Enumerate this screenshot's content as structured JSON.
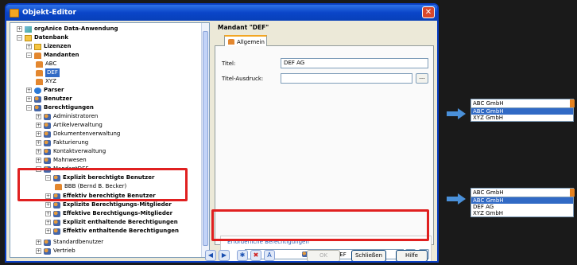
{
  "window": {
    "title": "Objekt-Editor"
  },
  "tree": {
    "items": [
      {
        "label": "orgAnice Data-Anwendung",
        "bold": true
      },
      {
        "label": "Datenbank",
        "bold": true
      },
      {
        "label": "Lizenzen",
        "bold": true
      },
      {
        "label": "Mandanten",
        "bold": true
      },
      {
        "label": "ABC",
        "bold": false
      },
      {
        "label": "DEF",
        "bold": false,
        "selected": true
      },
      {
        "label": "XYZ",
        "bold": false
      },
      {
        "label": "Parser",
        "bold": true
      },
      {
        "label": "Benutzer",
        "bold": true
      },
      {
        "label": "Berechtigungen",
        "bold": true
      },
      {
        "label": "Administratoren",
        "bold": false
      },
      {
        "label": "Artikelverwaltung",
        "bold": false
      },
      {
        "label": "Dokumentenverwaltung",
        "bold": false
      },
      {
        "label": "Fakturierung",
        "bold": false
      },
      {
        "label": "Kontaktverwaltung",
        "bold": false
      },
      {
        "label": "Mahnwesen",
        "bold": false
      },
      {
        "label": "MandantDEF",
        "bold": false
      },
      {
        "label": "Explizit berechtigte Benutzer",
        "bold": true
      },
      {
        "label": "BBB (Bernd B. Becker)",
        "bold": false
      },
      {
        "label": "Effektiv berechtigte Benutzer",
        "bold": true
      },
      {
        "label": "Explizite Berechtigungs-Mitglieder",
        "bold": true
      },
      {
        "label": "Effektive Berechtigungs-Mitglieder",
        "bold": true
      },
      {
        "label": "Explizit enthaltende Berechtigungen",
        "bold": true
      },
      {
        "label": "Effektiv enthaltende Berechtigungen",
        "bold": true
      },
      {
        "label": "Standardbenutzer",
        "bold": false
      },
      {
        "label": "Vertrieb",
        "bold": false
      }
    ]
  },
  "editor": {
    "header": "Mandant \"DEF\"",
    "tab_label": "Allgemein",
    "titel_label": "Titel:",
    "titel_value": "DEF AG",
    "titel_ausdruck_label": "Titel-Ausdruck:",
    "titel_ausdruck_value": "",
    "dots_label": "...",
    "group_title": "Erforderliche Berechtigungen",
    "combo_value": "MandantDEF"
  },
  "buttons": {
    "ok": "OK",
    "close": "Schließen",
    "help": "Hilfe"
  },
  "dropdown_top": {
    "selected": "ABC GmbH",
    "options": [
      "ABC GmbH",
      "XYZ GmbH"
    ]
  },
  "dropdown_bottom": {
    "selected": "ABC GmbH",
    "options": [
      "ABC GmbH",
      "DEF AG",
      "XYZ GmbH"
    ]
  },
  "colors": {
    "highlight": "#e02020",
    "accent": "#316ac5",
    "arrow": "#4a90d9"
  }
}
